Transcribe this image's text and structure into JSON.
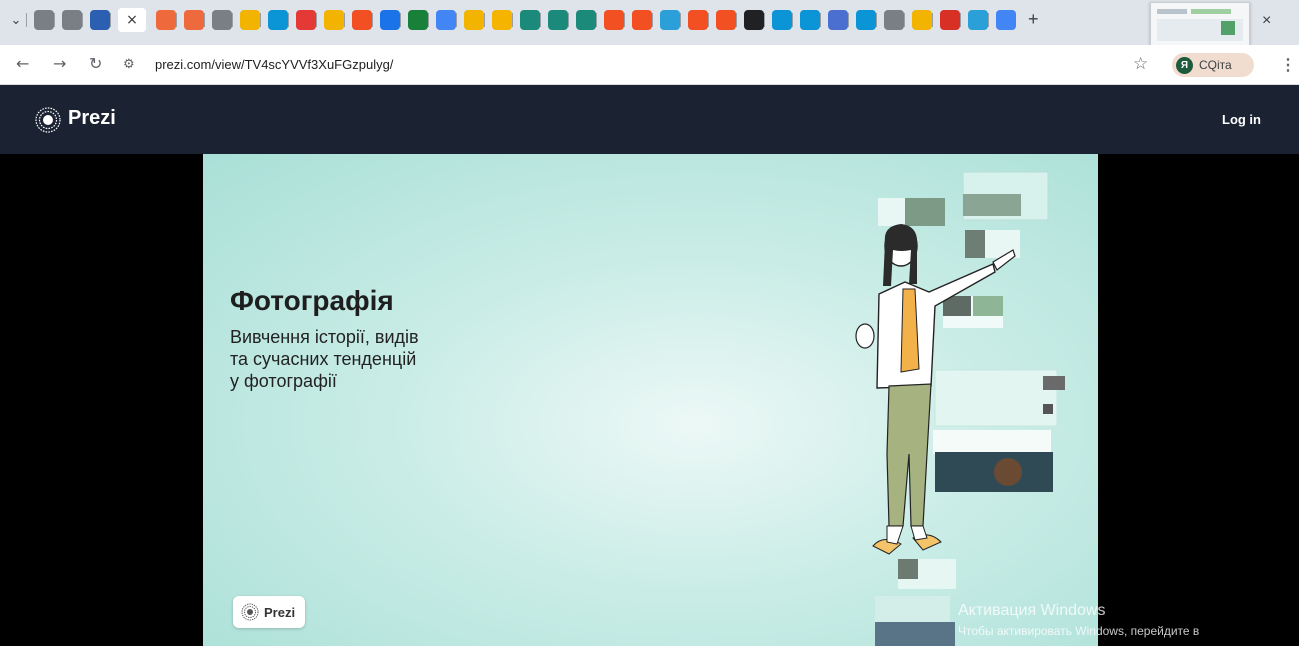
{
  "browser": {
    "tabs": [
      {
        "icon": "chevron-down-icon",
        "color": "#dfe3ea",
        "glyph": "⌄"
      },
      {
        "icon": "globe-icon",
        "color": "#7a7f86"
      },
      {
        "icon": "globe-icon",
        "color": "#7a7f86"
      },
      {
        "icon": "photo-icon",
        "color": "#2b5fb0"
      },
      {
        "icon": "close-icon",
        "active": true,
        "glyph": "×"
      },
      {
        "icon": "circle-icon",
        "color": "#ee6a3c"
      },
      {
        "icon": "circle-icon",
        "color": "#ee6a3c"
      },
      {
        "icon": "globe-icon",
        "color": "#7a7f86"
      },
      {
        "icon": "drive-icon",
        "color": "#f2b400"
      },
      {
        "icon": "c-icon",
        "color": "#0b94d6"
      },
      {
        "icon": "youtube-icon",
        "color": "#e53935"
      },
      {
        "icon": "drive-icon",
        "color": "#f2b400"
      },
      {
        "icon": "grid-icon",
        "color": "#f25022"
      },
      {
        "icon": "drop-icon",
        "color": "#1a73e8"
      },
      {
        "icon": "plus-square-icon",
        "color": "#188038"
      },
      {
        "icon": "calendar-icon",
        "color": "#4285f4"
      },
      {
        "icon": "drive-icon",
        "color": "#f2b400"
      },
      {
        "icon": "slides-icon",
        "color": "#f4b400"
      },
      {
        "icon": "p-icon",
        "color": "#1b8a7a"
      },
      {
        "icon": "p-icon",
        "color": "#1b8a7a"
      },
      {
        "icon": "p-icon",
        "color": "#1b8a7a"
      },
      {
        "icon": "grid-icon",
        "color": "#f25022"
      },
      {
        "icon": "grid-icon",
        "color": "#f25022"
      },
      {
        "icon": "telegram-icon",
        "color": "#2a9fd8"
      },
      {
        "icon": "grid-icon",
        "color": "#f25022"
      },
      {
        "icon": "grid-icon",
        "color": "#f25022"
      },
      {
        "icon": "openai-icon",
        "color": "#202124"
      },
      {
        "icon": "c-icon",
        "color": "#0b94d6"
      },
      {
        "icon": "c-icon",
        "color": "#0b94d6"
      },
      {
        "icon": "db-icon",
        "color": "#4a6fd1"
      },
      {
        "icon": "c-icon",
        "color": "#0b94d6"
      },
      {
        "icon": "globe-icon",
        "color": "#7a7f86"
      },
      {
        "icon": "drive-icon",
        "color": "#f2b400"
      },
      {
        "icon": "pin-icon",
        "color": "#d93025"
      },
      {
        "icon": "telegram-icon",
        "color": "#2a9fd8"
      },
      {
        "icon": "google-icon",
        "color": "#4285f4"
      }
    ],
    "new_tab_glyph": "+",
    "close_glyph": "×",
    "url": "prezi.com/view/TV4scYVVf3XuFGzpulyg/",
    "profile_initial": "Я",
    "profile_name": "CQ",
    "profile_name_suffix": "іта"
  },
  "prezi": {
    "logo_text": "Prezi",
    "login_label": "Log in",
    "slide": {
      "title": "Фотографія",
      "subtitle": "Вивчення історії, видів та сучасних тенденцій у фотографії",
      "badge_text": "Prezi"
    }
  },
  "watermark": {
    "line1": "Активация Windows",
    "line2": "Чтобы активировать Windows, перейдите в"
  }
}
